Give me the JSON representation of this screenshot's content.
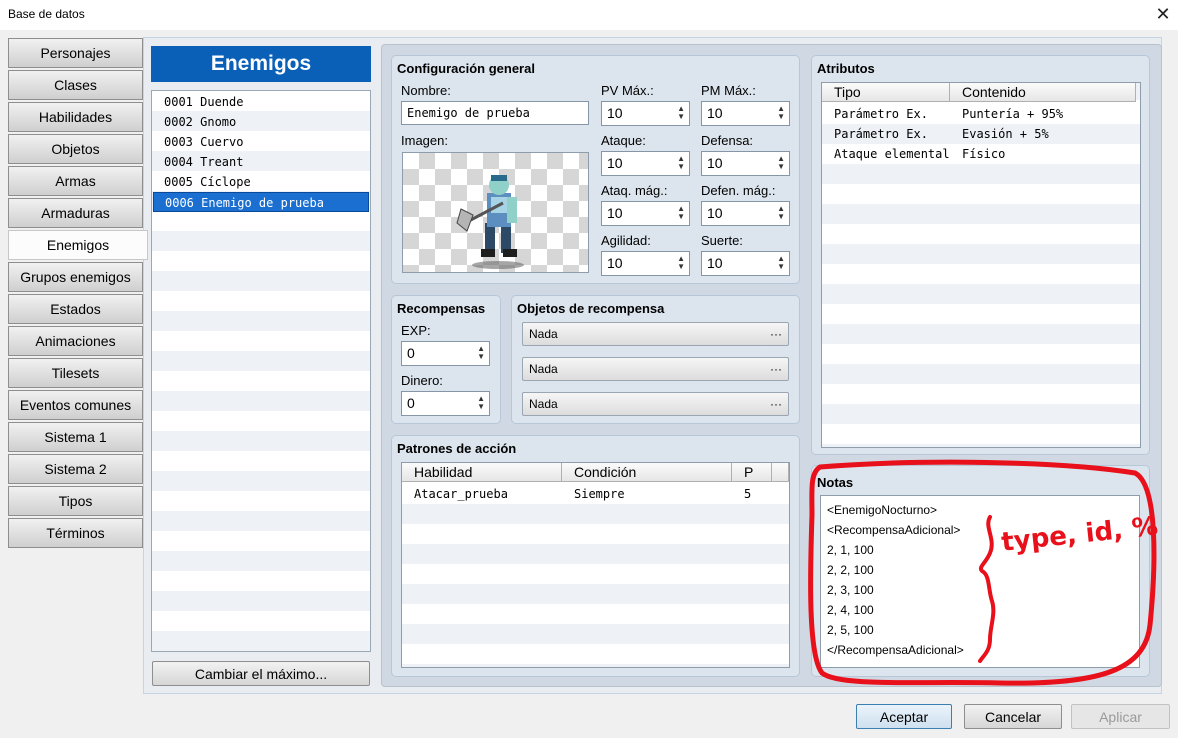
{
  "window": {
    "title": "Base de datos"
  },
  "tabs": [
    {
      "label": "Personajes"
    },
    {
      "label": "Clases"
    },
    {
      "label": "Habilidades"
    },
    {
      "label": "Objetos"
    },
    {
      "label": "Armas"
    },
    {
      "label": "Armaduras"
    },
    {
      "label": "Enemigos"
    },
    {
      "label": "Grupos enemigos"
    },
    {
      "label": "Estados"
    },
    {
      "label": "Animaciones"
    },
    {
      "label": "Tilesets"
    },
    {
      "label": "Eventos comunes"
    },
    {
      "label": "Sistema 1"
    },
    {
      "label": "Sistema 2"
    },
    {
      "label": "Tipos"
    },
    {
      "label": "Términos"
    }
  ],
  "enemies": {
    "header": "Enemigos",
    "items": [
      {
        "label": "0001 Duende"
      },
      {
        "label": "0002 Gnomo"
      },
      {
        "label": "0003 Cuervo"
      },
      {
        "label": "0004 Treant"
      },
      {
        "label": "0005 Cíclope"
      },
      {
        "label": "0006 Enemigo de prueba"
      }
    ],
    "change_max_label": "Cambiar el máximo..."
  },
  "general": {
    "title": "Configuración general",
    "name_label": "Nombre:",
    "name_value": "Enemigo de prueba",
    "image_label": "Imagen:",
    "hp_label": "PV Máx.:",
    "hp": "10",
    "mp_label": "PM Máx.:",
    "mp": "10",
    "atk_label": "Ataque:",
    "atk": "10",
    "def_label": "Defensa:",
    "def": "10",
    "mat_label": "Ataq. mág.:",
    "mat": "10",
    "mdf_label": "Defen. mág.:",
    "mdf": "10",
    "agi_label": "Agilidad:",
    "agi": "10",
    "luk_label": "Suerte:",
    "luk": "10"
  },
  "rewards": {
    "title": "Recompensas",
    "exp_label": "EXP:",
    "exp": "0",
    "gold_label": "Dinero:",
    "gold": "0"
  },
  "drops": {
    "title": "Objetos de recompensa",
    "items": [
      {
        "label": "Nada"
      },
      {
        "label": "Nada"
      },
      {
        "label": "Nada"
      }
    ],
    "dots": "···"
  },
  "actions": {
    "title": "Patrones de acción",
    "columns": [
      "Habilidad",
      "Condición",
      "P"
    ],
    "rows": [
      {
        "skill": "Atacar_prueba",
        "condition": "Siempre",
        "p": "5"
      }
    ]
  },
  "traits": {
    "title": "Atributos",
    "columns": [
      "Tipo",
      "Contenido"
    ],
    "rows": [
      {
        "type": "Parámetro Ex.",
        "content": "Puntería + 95%"
      },
      {
        "type": "Parámetro Ex.",
        "content": "Evasión + 5%"
      },
      {
        "type": "Ataque elemental",
        "content": "Físico"
      }
    ]
  },
  "notes": {
    "title": "Notas",
    "lines": [
      "<EnemigoNocturno>",
      "<RecompensaAdicional>",
      "2, 1, 100",
      "2, 2, 100",
      "2, 3, 100",
      "2, 4, 100",
      "2, 5, 100",
      "</RecompensaAdicional>"
    ],
    "annotation": "type, id, %",
    "annotation_color": "#e8101a"
  },
  "footer": {
    "ok": "Aceptar",
    "cancel": "Cancelar",
    "apply": "Aplicar"
  },
  "icons": {
    "close": "close-icon"
  }
}
